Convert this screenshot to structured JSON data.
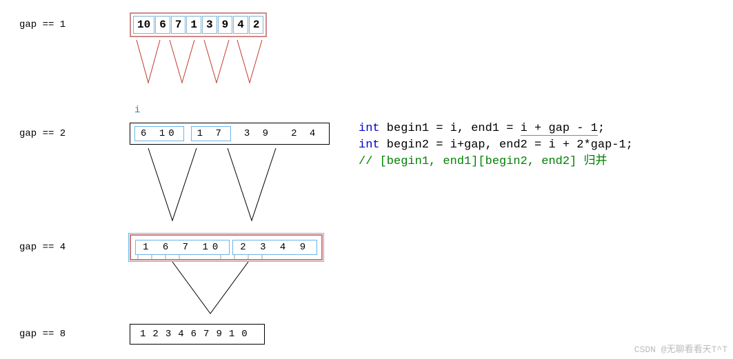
{
  "labels": {
    "gap1": "gap == 1",
    "gap2": "gap == 2",
    "gap4": "gap == 4",
    "gap8": "gap == 8",
    "i": "i"
  },
  "arrays": {
    "gap1": [
      "10",
      "6",
      "7",
      "1",
      "3",
      "9",
      "4",
      "2"
    ],
    "gap2": [
      [
        "6",
        "10"
      ],
      [
        "1",
        "7"
      ],
      [
        "3",
        "9"
      ],
      [
        "2",
        "4"
      ]
    ],
    "gap4": [
      [
        "1",
        "6",
        "7",
        "10"
      ],
      [
        "2",
        "3",
        "4",
        "9"
      ]
    ],
    "gap8": [
      "1",
      "2",
      "3",
      "4",
      "6",
      "7",
      "9",
      "10"
    ]
  },
  "code": {
    "l1a": "int",
    "l1b": " begin1 = i, end1 = ",
    "l1c": "i + gap - 1",
    "l1d": ";",
    "l2a": "int",
    "l2b": " begin2 = i+gap, end2 = i + 2*gap-1;",
    "l3": "// [begin1, end1][begin2, end2] 归并"
  },
  "watermark": "CSDN @无聊看看天T^T"
}
